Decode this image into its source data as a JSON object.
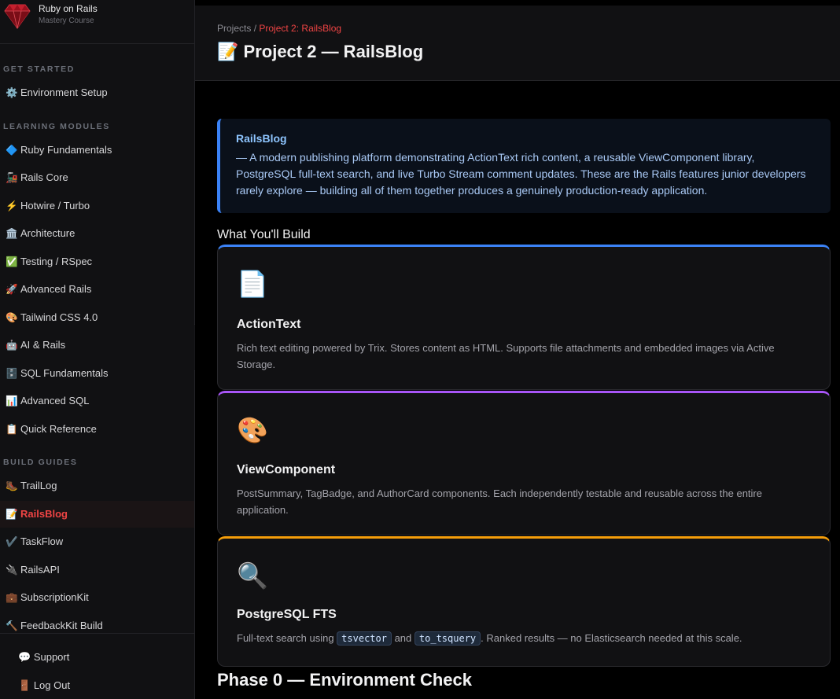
{
  "brand": {
    "title": "Ruby on Rails",
    "subtitle": "Mastery Course",
    "logo_icon": "ruby-gem-icon"
  },
  "sidebar": {
    "sections": [
      {
        "label": "GET STARTED",
        "items": [
          {
            "icon": "⚙️",
            "label": "Environment Setup"
          }
        ]
      },
      {
        "label": "LEARNING MODULES",
        "items": [
          {
            "icon": "🔷",
            "label": "Ruby Fundamentals"
          },
          {
            "icon": "🚂",
            "label": "Rails Core"
          },
          {
            "icon": "⚡",
            "label": "Hotwire / Turbo"
          },
          {
            "icon": "🏛️",
            "label": "Architecture"
          },
          {
            "icon": "✅",
            "label": "Testing / RSpec"
          },
          {
            "icon": "🚀",
            "label": "Advanced Rails"
          },
          {
            "icon": "🎨",
            "label": "Tailwind CSS 4.0"
          },
          {
            "icon": "🤖",
            "label": "AI & Rails"
          },
          {
            "icon": "🗄️",
            "label": "SQL Fundamentals"
          },
          {
            "icon": "📊",
            "label": "Advanced SQL"
          },
          {
            "icon": "📋",
            "label": "Quick Reference"
          }
        ]
      },
      {
        "label": "BUILD GUIDES",
        "items": [
          {
            "icon": "🥾",
            "label": "TrailLog"
          },
          {
            "icon": "📝",
            "label": "RailsBlog",
            "active": true
          },
          {
            "icon": "✔️",
            "label": "TaskFlow"
          },
          {
            "icon": "🔌",
            "label": "RailsAPI"
          },
          {
            "icon": "💼",
            "label": "SubscriptionKit"
          },
          {
            "icon": "🔨",
            "label": "FeedbackKit Build"
          }
        ]
      }
    ],
    "footer": [
      {
        "icon": "💬",
        "label": "Support"
      },
      {
        "icon": "🚪",
        "label": "Log Out"
      }
    ],
    "collapse_glyph": "‹"
  },
  "header": {
    "breadcrumb_root": "Projects",
    "breadcrumb_sep": " / ",
    "breadcrumb_current": "Project 2: RailsBlog",
    "title_icon": "📝",
    "title": "Project 2 — RailsBlog"
  },
  "callout": {
    "title": "RailsBlog",
    "text": "— A modern publishing platform demonstrating ActionText rich content, a reusable ViewComponent library, PostgreSQL full-text search, and live Turbo Stream comment updates. These are the Rails features junior developers rarely explore — building all of them together produces a genuinely production-ready application."
  },
  "build_heading": "What You'll Build",
  "cards": [
    {
      "emoji": "📄",
      "name": "ActionText",
      "accent": "#3b82f6",
      "desc": "Rich text editing powered by Trix. Stores content as HTML. Supports file attachments and embedded images via Active Storage."
    },
    {
      "emoji": "🎨",
      "name": "ViewComponent",
      "accent": "#a855f7",
      "desc": "PostSummary, TagBadge, and AuthorCard components. Each independently testable and reusable across the entire application."
    },
    {
      "emoji": "🔍",
      "name": "PostgreSQL FTS",
      "accent": "#f59e0b",
      "desc_parts": [
        "Full-text search using ",
        "tsvector",
        " and ",
        "to_tsquery",
        ". Ranked results — no Elasticsearch needed at this scale."
      ]
    }
  ],
  "phase_heading": "Phase 0 — Environment Check",
  "colors": {
    "accent_red": "#ef4444",
    "callout_border": "#3b82f6",
    "background": "#000000",
    "panel": "#111113"
  }
}
